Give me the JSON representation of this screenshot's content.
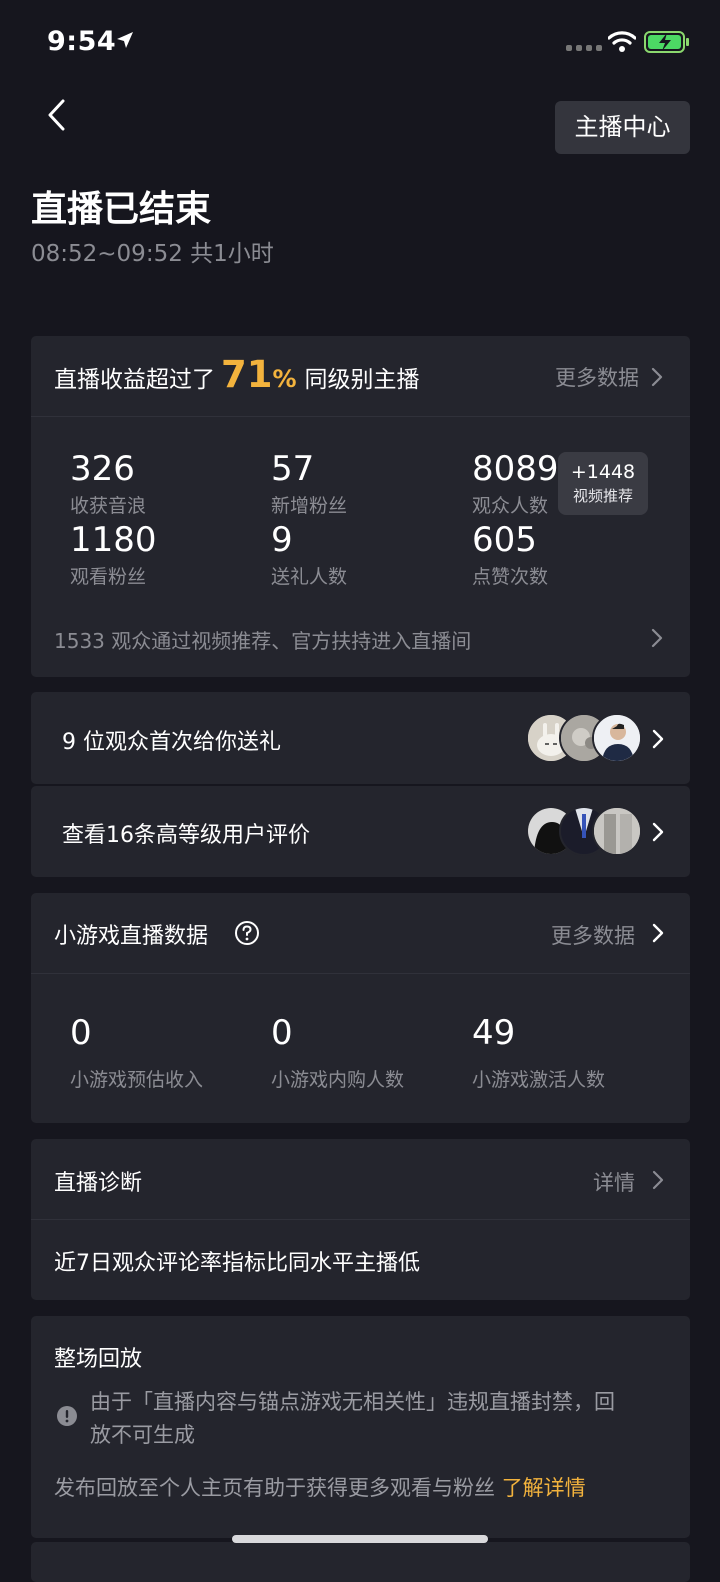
{
  "status_bar": {
    "time": "9:54"
  },
  "header": {
    "anchor_center_label": "主播中心",
    "title": "直播已结束",
    "subtitle": "08:52~09:52 共1小时"
  },
  "revenue": {
    "prefix": "直播收益超过了",
    "percent": "71",
    "percent_sign": "%",
    "suffix": "同级别主播",
    "more_label": "更多数据",
    "stats": [
      {
        "value": "326",
        "label": "收获音浪"
      },
      {
        "value": "57",
        "label": "新增粉丝"
      },
      {
        "value": "8089",
        "label": "观众人数"
      },
      {
        "value": "1180",
        "label": "观看粉丝"
      },
      {
        "value": "9",
        "label": "送礼人数"
      },
      {
        "value": "605",
        "label": "点赞次数"
      }
    ],
    "recommend_badge": {
      "value": "+1448",
      "label": "视频推荐"
    },
    "footer_text": "1533 观众通过视频推荐、官方扶持进入直播间"
  },
  "gift_row": {
    "text": "9 位观众首次给你送礼"
  },
  "review_row": {
    "text": "查看16条高等级用户评价"
  },
  "minigame": {
    "title": "小游戏直播数据",
    "more_label": "更多数据",
    "stats": [
      {
        "value": "0",
        "label": "小游戏预估收入"
      },
      {
        "value": "0",
        "label": "小游戏内购人数"
      },
      {
        "value": "49",
        "label": "小游戏激活人数"
      }
    ]
  },
  "diagnosis": {
    "title": "直播诊断",
    "detail_label": "详情",
    "content": "近7日观众评论率指标比同水平主播低"
  },
  "replay": {
    "title": "整场回放",
    "warning_line1": "由于「直播内容与锚点游戏无相关性」违规直播封禁，回",
    "warning_line2": "放不可生成",
    "tip_text": "发布回放至个人主页有助于获得更多观看与粉丝",
    "tip_link": "了解详情"
  },
  "colors": {
    "background": "#16161e",
    "card": "#24252d",
    "accent": "#f3b33d",
    "muted": "#8b8c93"
  }
}
